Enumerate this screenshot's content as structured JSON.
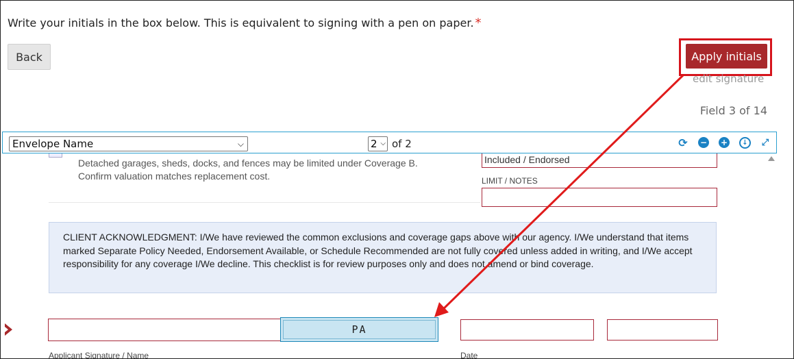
{
  "header": {
    "instruction": "Write your initials in the box below. This is equivalent to signing with a pen on paper.",
    "required_mark": "*"
  },
  "buttons": {
    "back_label": "Back",
    "apply_label": "Apply initials",
    "edit_signature_label": "edit signature"
  },
  "status": {
    "field_counter": "Field 3 of 14"
  },
  "toolbar": {
    "envelope_select_value": "Envelope Name",
    "page_select_value": "2",
    "page_of": "of 2",
    "icons": [
      "refresh-icon",
      "zoom-out-icon",
      "zoom-in-icon",
      "download-icon",
      "expand-icon"
    ]
  },
  "document": {
    "note_line_1": "Detached garages, sheds, docks, and fences may be limited under Coverage B.",
    "note_line_2": "Confirm valuation matches replacement cost.",
    "coverage_field_value": "Included / Endorsed",
    "limit_label": "LIMIT / NOTES",
    "limit_field_value": "",
    "acknowledgment": "CLIENT ACKNOWLEDGMENT: I/We have reviewed the common exclusions and coverage gaps above with our agency. I/We understand that items marked Separate Policy Needed, Endorsement Available, or Schedule Recommended are not fully covered unless added in writing, and I/We accept responsibility for any coverage I/We decline. This checklist is for review purposes only and does not amend or bind coverage.",
    "applicant_signature_value": "",
    "initials_value": "PA",
    "date_field_1_value": "",
    "date_field_2_value": "",
    "applicant_label": "Applicant Signature / Name",
    "date_label": "Date"
  },
  "colors": {
    "apply_button": "#a8282b",
    "highlight": "#d6141c",
    "accent": "#1a82c4",
    "field_border": "#a8283a"
  }
}
